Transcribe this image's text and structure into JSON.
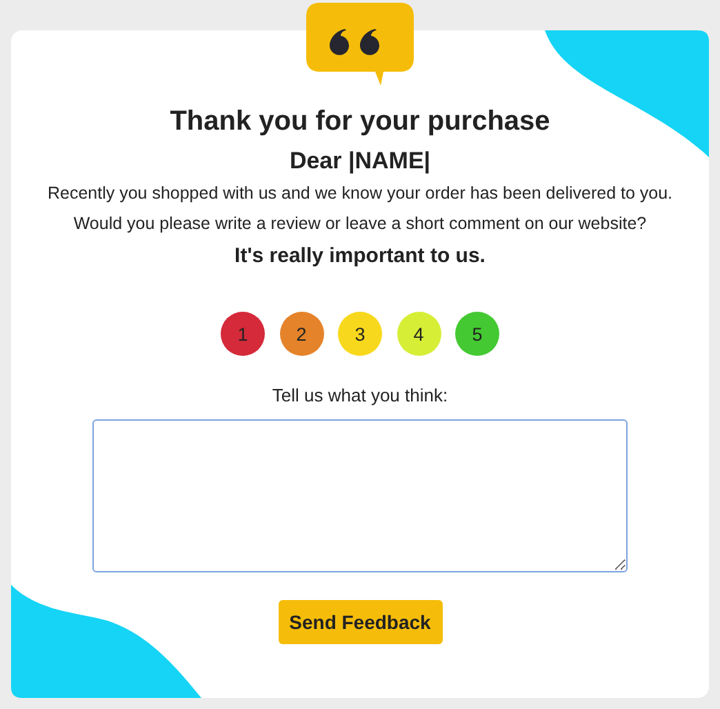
{
  "title": "Thank you for your purchase",
  "greeting": "Dear |NAME|",
  "paragraphs": [
    "Recently you shopped with us and we know your order has been delivered to you.",
    "Would you please write a review or leave a short comment on our website?"
  ],
  "emphasis": "It's really important to us.",
  "ratings": [
    {
      "label": "1",
      "color": "#d42a3a"
    },
    {
      "label": "2",
      "color": "#e5832a"
    },
    {
      "label": "3",
      "color": "#f8d81c"
    },
    {
      "label": "4",
      "color": "#d6ee36"
    },
    {
      "label": "5",
      "color": "#44c932"
    }
  ],
  "comment_label": "Tell us what you think:",
  "submit": "Send Feedback"
}
